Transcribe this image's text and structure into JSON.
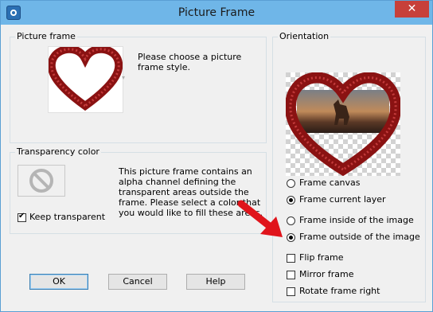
{
  "window": {
    "title": "Picture Frame",
    "close_glyph": "✕"
  },
  "picture_frame_group": {
    "legend": "Picture frame",
    "instruction": "Please choose a picture frame style.",
    "thumbnail": "heart-frame-thumbnail"
  },
  "transparency_group": {
    "legend": "Transparency color",
    "description": "This picture frame contains an alpha channel defining the transparent areas outside the frame.  Please select a color that you would like to fill these areas.",
    "keep_transparent": {
      "label": "Keep transparent",
      "checked": true
    }
  },
  "orientation_group": {
    "legend": "Orientation",
    "preview": "heart-frame-preview",
    "options": [
      {
        "label": "Frame canvas",
        "selected": false
      },
      {
        "label": "Frame current layer",
        "selected": true
      },
      {
        "label": "Frame inside of the image",
        "selected": false
      },
      {
        "label": "Frame outside of the image",
        "selected": true
      }
    ],
    "toggles": [
      {
        "label": "Flip frame",
        "checked": false
      },
      {
        "label": "Mirror frame",
        "checked": false
      },
      {
        "label": "Rotate frame right",
        "checked": false
      }
    ]
  },
  "buttons": {
    "ok": "OK",
    "cancel": "Cancel",
    "help": "Help"
  },
  "colors": {
    "titlebar": "#6fb6e8",
    "close": "#c7403a",
    "frame_red": "#9c1818",
    "annotation_arrow": "#e0141b"
  }
}
